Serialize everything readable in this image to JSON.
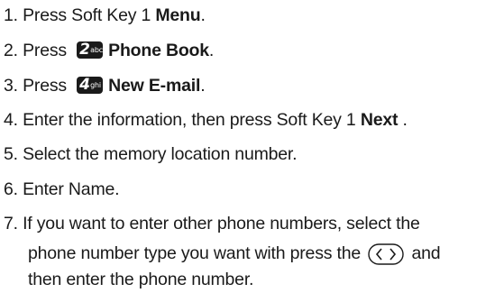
{
  "steps": [
    {
      "num": "1.",
      "pre": " Press Soft Key 1 ",
      "bold": "Menu",
      "post": "."
    },
    {
      "num": "2.",
      "pre": " Press ",
      "key_digit": "2",
      "key_letters": "abc",
      "bold": "Phone Book",
      "post": "."
    },
    {
      "num": "3.",
      "pre": " Press ",
      "key_digit": "4",
      "key_letters": "ghi",
      "bold": "New E-mail",
      "post": "."
    },
    {
      "num": "4.",
      "pre": " Enter the information, then press Soft Key 1 ",
      "bold": "Next",
      "post": " ."
    },
    {
      "num": "5.",
      "text": " Select the memory location number."
    },
    {
      "num": "6.",
      "text": " Enter Name."
    },
    {
      "num": "7.",
      "text": " If you want to enter other phone numbers, select the"
    }
  ],
  "step7_line2_pre": "phone number type you want with press the ",
  "step7_line2_post": " and",
  "step7_line3": "then enter the  phone number.",
  "icons": {
    "key2": "keypad-2-abc-icon",
    "key4": "keypad-4-ghi-icon",
    "nav": "left-right-navigation-key-icon"
  }
}
